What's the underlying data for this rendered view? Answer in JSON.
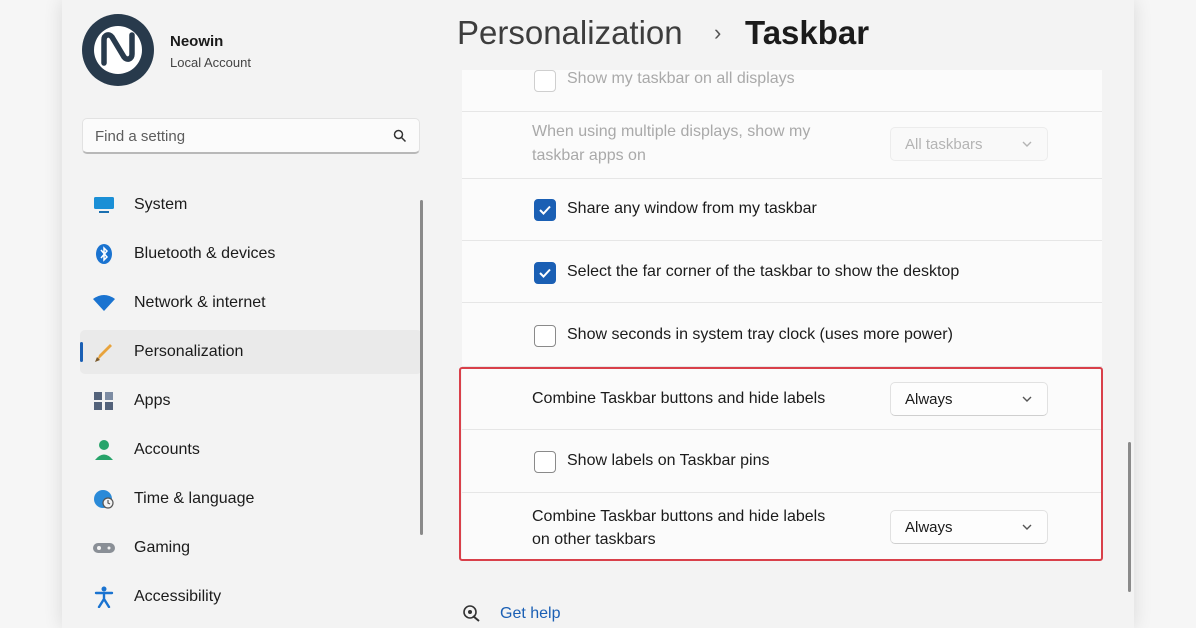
{
  "profile": {
    "name": "Neowin",
    "account_type": "Local Account"
  },
  "search": {
    "placeholder": "Find a setting",
    "icon": "search-icon"
  },
  "sidebar": {
    "items": [
      {
        "label": "System",
        "icon": "system-icon",
        "active": false
      },
      {
        "label": "Bluetooth & devices",
        "icon": "bluetooth-icon",
        "active": false
      },
      {
        "label": "Network & internet",
        "icon": "wifi-icon",
        "active": false
      },
      {
        "label": "Personalization",
        "icon": "brush-icon",
        "active": true
      },
      {
        "label": "Apps",
        "icon": "apps-icon",
        "active": false
      },
      {
        "label": "Accounts",
        "icon": "person-icon",
        "active": false
      },
      {
        "label": "Time & language",
        "icon": "globe-clock-icon",
        "active": false
      },
      {
        "label": "Gaming",
        "icon": "gamepad-icon",
        "active": false
      },
      {
        "label": "Accessibility",
        "icon": "accessibility-icon",
        "active": false
      }
    ]
  },
  "breadcrumb": {
    "parent": "Personalization",
    "separator": "›",
    "current": "Taskbar"
  },
  "settings": {
    "all_displays": {
      "label": "Show my taskbar on all displays",
      "checked": false,
      "disabled": true
    },
    "multi_display": {
      "label_line1": "When using multiple displays, show my",
      "label_line2": "taskbar apps on",
      "value": "All taskbars",
      "disabled": true
    },
    "share_window": {
      "label": "Share any window from my taskbar",
      "checked": true
    },
    "far_corner": {
      "label": "Select the far corner of the taskbar to show the desktop",
      "checked": true
    },
    "show_seconds": {
      "label": "Show seconds in system tray clock (uses more power)",
      "checked": false
    },
    "combine_buttons": {
      "label": "Combine Taskbar buttons and hide labels",
      "value": "Always"
    },
    "show_labels_pins": {
      "label": "Show labels on Taskbar pins",
      "checked": false
    },
    "combine_other": {
      "label_line1": "Combine Taskbar buttons and hide labels",
      "label_line2": "on other taskbars",
      "value": "Always"
    }
  },
  "help": {
    "label": "Get help"
  },
  "colors": {
    "accent": "#1a5fb4",
    "highlight_border": "#d9404a"
  }
}
